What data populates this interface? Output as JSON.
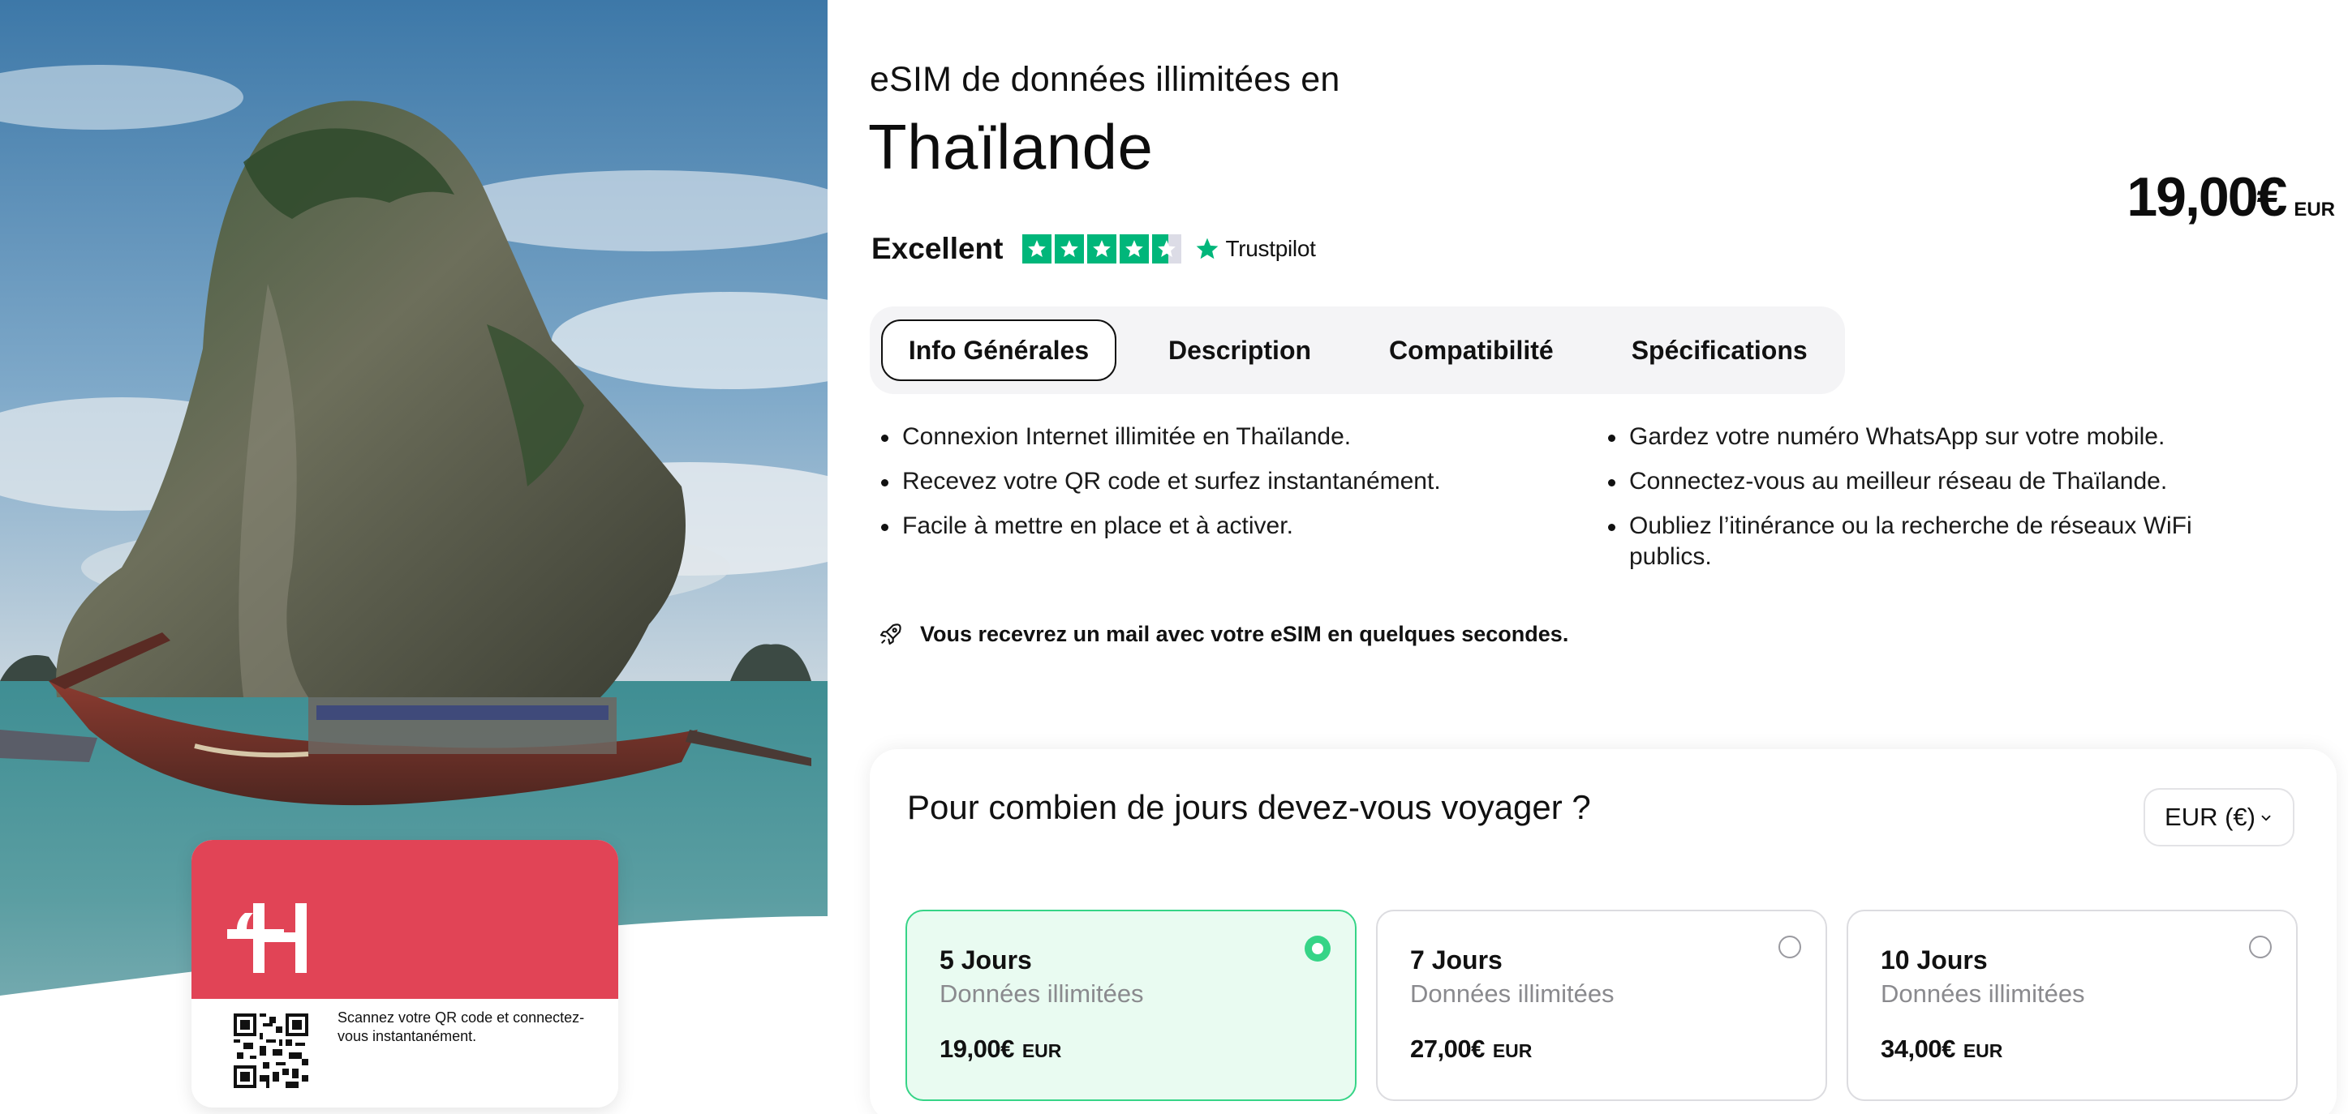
{
  "hero": {
    "card": {
      "qr_text": "Scannez votre QR code et connectez-vous instantanément."
    }
  },
  "product": {
    "subtitle": "eSIM de données illimitées en",
    "title": "Thaïlande",
    "price": "19,00€",
    "currency_code": "EUR"
  },
  "rating": {
    "label": "Excellent",
    "provider": "Trustpilot",
    "stars": 4.5
  },
  "tabs": [
    {
      "label": "Info Générales",
      "active": true
    },
    {
      "label": "Description",
      "active": false
    },
    {
      "label": "Compatibilité",
      "active": false
    },
    {
      "label": "Spécifications",
      "active": false
    }
  ],
  "features": {
    "left": [
      "Connexion Internet illimitée en Thaïlande.",
      "Recevez votre QR code et surfez instantanément.",
      "Facile à mettre en place et à activer."
    ],
    "right": [
      "Gardez votre numéro WhatsApp sur votre mobile.",
      "Connectez-vous au meilleur réseau de Thaïlande.",
      "Oubliez l’itinérance ou la recherche de réseaux WiFi publics."
    ]
  },
  "mail_note": "Vous recevrez un mail avec votre eSIM en quelques secondes.",
  "plans": {
    "question": "Pour combien de jours devez-vous voyager ?",
    "currency_select": "EUR (€)",
    "options": [
      {
        "days": "5 Jours",
        "data": "Données illimitées",
        "price": "19,00€",
        "currency": "EUR",
        "selected": true
      },
      {
        "days": "7 Jours",
        "data": "Données illimitées",
        "price": "27,00€",
        "currency": "EUR",
        "selected": false
      },
      {
        "days": "10 Jours",
        "data": "Données illimitées",
        "price": "34,00€",
        "currency": "EUR",
        "selected": false
      }
    ]
  },
  "colors": {
    "brand_red": "#e14456",
    "accent_green": "#36d487",
    "trustpilot_green": "#00b67a",
    "selected_bg": "#e9fbf1"
  }
}
